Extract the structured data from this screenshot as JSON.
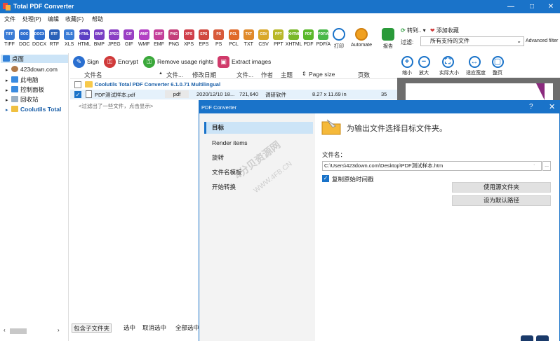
{
  "window": {
    "title": "Total PDF Converter",
    "minimize": "—",
    "maximize": "□",
    "close": "✕"
  },
  "menu": [
    "文件",
    "处理(P)",
    "编辑",
    "收藏(F)",
    "帮助"
  ],
  "toolbar": {
    "formats": [
      {
        "label": "TIFF",
        "color": "#3a7bd5"
      },
      {
        "label": "DOC",
        "color": "#2f6fd0"
      },
      {
        "label": "DOCX",
        "color": "#2f6fd0"
      },
      {
        "label": "RTF",
        "color": "#2a60b8"
      },
      {
        "label": "XLS",
        "color": "#3a7bd5"
      },
      {
        "label": "HTML",
        "color": "#5b3fc4"
      },
      {
        "label": "BMP",
        "color": "#7a3fc4"
      },
      {
        "label": "JPEG",
        "color": "#8a3fc4"
      },
      {
        "label": "GIF",
        "color": "#9a3fc4"
      },
      {
        "label": "WMF",
        "color": "#b33fc4"
      },
      {
        "label": "EMF",
        "color": "#c43f9a"
      },
      {
        "label": "PNG",
        "color": "#c43f7a"
      },
      {
        "label": "XPS",
        "color": "#d03f4a"
      },
      {
        "label": "EPS",
        "color": "#d0483f"
      },
      {
        "label": "PS",
        "color": "#d85a3a"
      },
      {
        "label": "PCL",
        "color": "#e06a2a"
      },
      {
        "label": "TXT",
        "color": "#e08a2a"
      },
      {
        "label": "CSV",
        "color": "#d9a82a"
      },
      {
        "label": "PPT",
        "color": "#b8b82a"
      },
      {
        "label": "XHTML",
        "color": "#7ab82a"
      },
      {
        "label": "PDF",
        "color": "#5ab82a"
      },
      {
        "label": "PDF/A",
        "color": "#4ab84a"
      }
    ],
    "print_label": "打印",
    "automate_label": "Automate",
    "report_label": "报告"
  },
  "right_pane": {
    "goto_label": "转到.. ▾",
    "favorite_label": "添加收藏",
    "filter_label": "过滤:",
    "filter_value": "所有支持的文件",
    "advanced_filter": "Advanced filter",
    "view_tools": [
      {
        "label": "缩小",
        "glyph": "+"
      },
      {
        "label": "放大",
        "glyph": "−"
      },
      {
        "label": "实际大小",
        "glyph": "⛶"
      },
      {
        "label": "适应宽度",
        "glyph": "↔"
      },
      {
        "label": "整页",
        "glyph": "▢"
      }
    ]
  },
  "tree": {
    "items": [
      {
        "label": "桌面",
        "color": "#2f7fd8"
      },
      {
        "label": "423down.com",
        "color": "#b07a4a"
      },
      {
        "label": "此电脑",
        "color": "#3a8be0"
      },
      {
        "label": "控制面板",
        "color": "#3a8be0"
      },
      {
        "label": "回收站",
        "color": "#9ab0c4"
      },
      {
        "label": "Coolutils Total",
        "color": "#f0c040"
      }
    ]
  },
  "actions": [
    {
      "label": "Sign",
      "color": "#2a6fd0",
      "glyph": "✎"
    },
    {
      "label": "Encrypt",
      "color": "#d03a3a",
      "glyph": "🔒"
    },
    {
      "label": "Remove usage rights",
      "color": "#3aa83a",
      "glyph": "🔓"
    },
    {
      "label": "Extract images",
      "color": "#d03a6a",
      "glyph": "▣"
    }
  ],
  "file_list": {
    "headers": [
      "文件名",
      "文件...",
      "修改日期",
      "文件...",
      "作者",
      "主题",
      "Page size",
      "页数"
    ],
    "group_label": "Coolutils Total PDF Converter 6.1.0.71 Multilingual",
    "file": {
      "name": "PDF测试样本.pdf",
      "type": "pdf",
      "date": "2020/12/10 18...",
      "size": "721,640",
      "author": "调研软件",
      "page_size": "8.27 x 11.69 in",
      "pages": "35"
    },
    "filter_note": "<过滤出了一些文件，点击显示>"
  },
  "bottom": {
    "include_sub": "包含子文件夹",
    "select": "选中",
    "deselect": "取消选中",
    "select_all": "全部选中"
  },
  "dialog": {
    "title": "PDF Converter",
    "help": "?",
    "close": "✕",
    "nav": [
      "目标",
      "Render items",
      "旋转",
      "文件名模板",
      "开始转换"
    ],
    "heading": "为输出文件选择目标文件夹。",
    "filename_label": "文件名：",
    "filename_value": "C:\\Users\\423down.com\\Desktop\\PDF测试样本.htm",
    "input_btn1": "·",
    "input_btn2": "...",
    "copy_time_label": "复制原始时间戳",
    "use_source_folder": "使用源文件夹",
    "set_default": "设为默认路径"
  },
  "watermark": {
    "line1": "4分贝资源网",
    "line2": "WWW.4FB.CN"
  }
}
